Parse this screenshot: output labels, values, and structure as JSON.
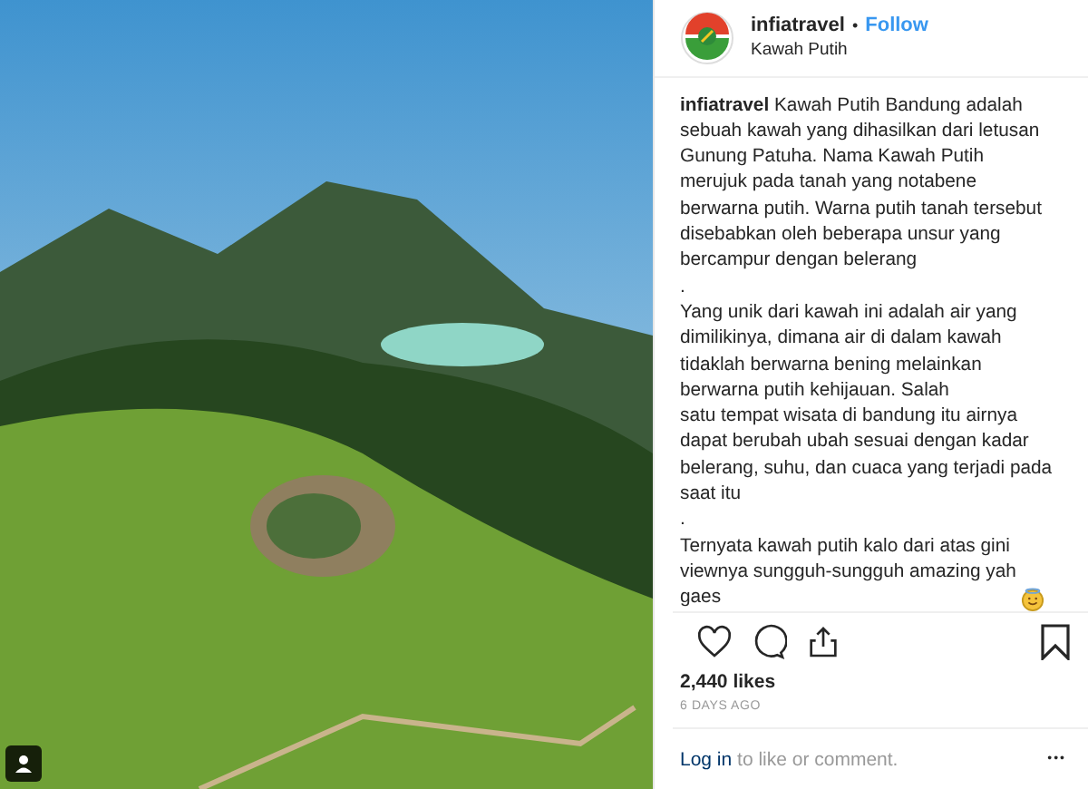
{
  "post": {
    "tag_badge": true
  },
  "header": {
    "username": "infiatravel",
    "separator": "•",
    "follow": "Follow",
    "location": "Kawah Putih"
  },
  "caption": [
    {
      "kind": "text",
      "text": "**infiatravel** Kawah Putih Bandung adalah\nsebuah kawah yang dihasilkan dari letusan\nGunung Patuha. Nama Kawah Putih\nmerujuk pada tanah yang notabene\nberwarna putih. Warna putih tanah tersebut\ndisebabkan oleh beberapa unsur yang\nbercampur dengan belerang"
    },
    {
      "kind": "text",
      "text": "."
    },
    {
      "kind": "text",
      "text": "Yang unik dari kawah ini adalah air yang\ndimilikinya, dimana air di dalam kawah\ntidaklah berwarna bening melainkan\nberwarna putih kehijauan. Salah\nsatu tempat wisata di bandung itu airnya\ndapat berubah ubah sesuai dengan kadar\nbelerang, suhu, dan cuaca yang terjadi pada\nsaat itu"
    },
    {
      "kind": "text",
      "text": "."
    },
    {
      "kind": "emoji_end",
      "text": "Ternyata kawah putih kalo dari atas gini\nviewnya sungguh-sungguh amazing yah\ngaes"
    }
  ],
  "likes": "2,440 likes",
  "time": "6 DAYS AGO",
  "footer": {
    "login": "Log in",
    "rest": "to like or comment.",
    "more": "•••"
  }
}
